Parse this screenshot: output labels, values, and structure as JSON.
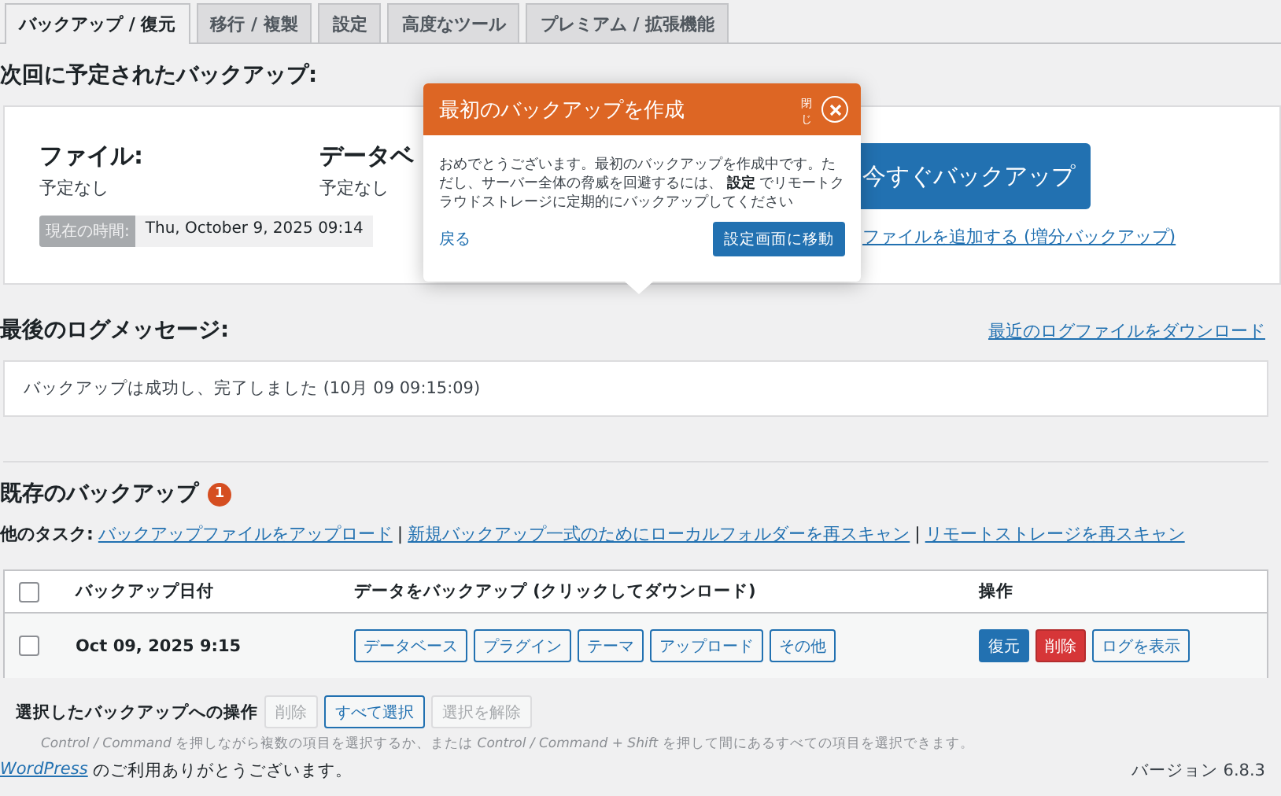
{
  "tabs": [
    {
      "label": "バックアップ / 復元",
      "selected": true
    },
    {
      "label": "移行 / 複製",
      "selected": false
    },
    {
      "label": "設定",
      "selected": false
    },
    {
      "label": "高度なツール",
      "selected": false
    },
    {
      "label": "プレミアム / 拡張機能",
      "selected": false
    }
  ],
  "next_backup": {
    "heading": "次回に予定されたバックアップ:",
    "files_label": "ファイル:",
    "files_value": "予定なし",
    "database_label": "データベ",
    "database_value": "予定なし",
    "time_label": "現在の時間:",
    "time_value": "Thu, October 9, 2025 09:14",
    "backup_button": "今すぐバックアップ",
    "incremental_link": "ファイルを追加する (増分バックアップ)"
  },
  "popover": {
    "title": "最初のバックアップを作成",
    "close_label": "閉じ",
    "body": "おめでとうございます。最初のバックアップを作成中です。ただし、サーバー全体の脅威を回避するには、 **設定** でリモートクラウドストレージに定期的にバックアップしてください",
    "back_link": "戻る",
    "settings_button": "設定画面に移動"
  },
  "log": {
    "heading": "最後のログメッセージ:",
    "download_link": "最近のログファイルをダウンロード",
    "message": "バックアップは成功し、完了しました (10月 09 09:15:09)"
  },
  "existing": {
    "heading": "既存のバックアップ",
    "count": "1",
    "tasks_label": "他のタスク:",
    "tasks": [
      {
        "kind": "link",
        "text": "バックアップファイルをアップロード"
      },
      {
        "kind": "separator",
        "text": "|"
      },
      {
        "kind": "link",
        "text": "新規バックアップ一式のためにローカルフォルダーを再スキャン"
      },
      {
        "kind": "separator",
        "text": "|"
      },
      {
        "kind": "link",
        "text": "リモートストレージを再スキャン"
      }
    ]
  },
  "table": {
    "select_all_checked": false,
    "columns": [
      "バックアップ日付",
      "データをバックアップ (クリックしてダウンロード)",
      "操作"
    ],
    "rows": [
      {
        "checked": false,
        "date": "Oct 09, 2025 9:15",
        "data_buttons": [
          "データベース",
          "プラグイン",
          "テーマ",
          "アップロード",
          "その他"
        ],
        "actions": [
          {
            "label": "復元",
            "kind": "primary"
          },
          {
            "label": "削除",
            "kind": "danger"
          },
          {
            "label": "ログを表示",
            "kind": "secondary"
          }
        ]
      }
    ]
  },
  "bulk": {
    "label": "選択したバックアップへの操作",
    "buttons": [
      {
        "label": "削除",
        "disabled": true
      },
      {
        "label": "すべて選択",
        "disabled": false
      },
      {
        "label": "選択を解除",
        "disabled": true
      }
    ],
    "note": "*Control / Command* を押しながら複数の項目を選択するか、または *Control / Command + Shift* を押して間にあるすべての項目を選択できます。"
  },
  "footer": {
    "link": "WordPress",
    "text": "のご利用ありがとうございます。",
    "version": "バージョン 6.8.3"
  }
}
